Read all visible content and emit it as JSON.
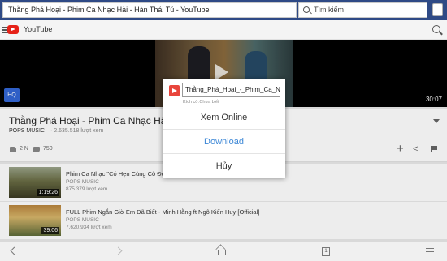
{
  "browser": {
    "url": "Thằng Phá Hoại - Phim Ca Nhạc Hài - Hàn Thái Tú - YouTube",
    "search_label": "Tìm kiếm"
  },
  "youtube": {
    "brand": "YouTube"
  },
  "player": {
    "hq_label": "HQ",
    "duration": "30:07"
  },
  "video": {
    "title": "Thằng Phá Hoại - Phim Ca Nhạc Hài - Hàn T",
    "channel": "POPS MUSIC",
    "views": "· 2.635.518 lượt xem",
    "likes": "2 N",
    "dislikes": "750"
  },
  "related": [
    {
      "title": "Phim Ca Nhạc \"Có Hẹn Cùng Cô Đơn\" - ...95 [Official]",
      "channel": "POPS MUSIC",
      "views": "875.379 lượt xem",
      "duration": "1:19:26"
    },
    {
      "title": "FULL Phim Ngắn Giờ Em Đã Biết - Minh Hằng ft Ngô Kiến Huy [Official]",
      "channel": "POPS MUSIC",
      "views": "7.620.934 lượt xem",
      "duration": "39:06"
    }
  ],
  "dialog": {
    "filename": "Thằng_Phá_Hoại_-_Phim_Ca_Nhạc",
    "size_label": "Kích cỡ:Chưa biết",
    "options": [
      "Xem Online",
      "Download",
      "Hủy"
    ]
  },
  "bottom_nav": {
    "tabs_count": "1"
  },
  "colors": {
    "browser_bar": "#2f4a86",
    "download_accent": "#3c87d6",
    "youtube_red": "#e62117"
  }
}
